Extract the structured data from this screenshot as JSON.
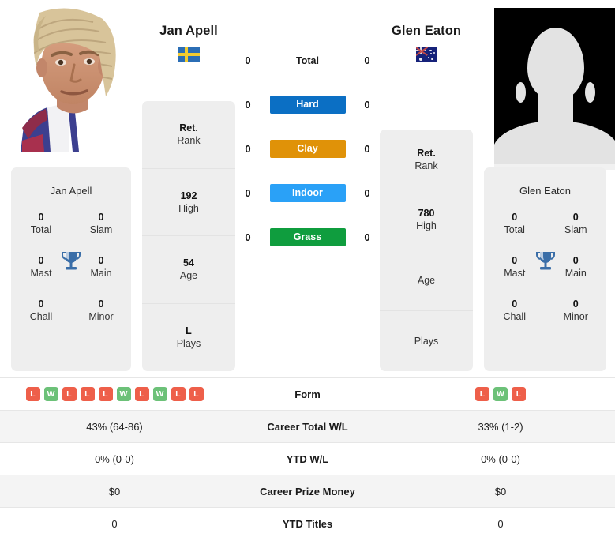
{
  "players": {
    "left": {
      "name": "Jan Apell",
      "flag": "sweden-flag",
      "photo": "player-photo",
      "titles_card_name": "Jan Apell",
      "titles": [
        {
          "value": "0",
          "label": "Total"
        },
        {
          "value": "0",
          "label": "Slam"
        },
        {
          "value": "0",
          "label": "Mast"
        },
        {
          "value": "0",
          "label": "Main"
        },
        {
          "value": "0",
          "label": "Chall"
        },
        {
          "value": "0",
          "label": "Minor"
        }
      ],
      "profile": [
        {
          "value": "Ret.",
          "label": "Rank"
        },
        {
          "value": "192",
          "label": "High"
        },
        {
          "value": "54",
          "label": "Age"
        },
        {
          "value": "L",
          "label": "Plays"
        }
      ],
      "form": [
        "L",
        "W",
        "L",
        "L",
        "L",
        "W",
        "L",
        "W",
        "L",
        "L"
      ],
      "career_total_wl": "43% (64-86)",
      "ytd_wl": "0% (0-0)",
      "career_prize_money": "$0",
      "ytd_titles": "0"
    },
    "right": {
      "name": "Glen Eaton",
      "flag": "australia-flag",
      "photo": "avatar-placeholder",
      "titles_card_name": "Glen Eaton",
      "titles": [
        {
          "value": "0",
          "label": "Total"
        },
        {
          "value": "0",
          "label": "Slam"
        },
        {
          "value": "0",
          "label": "Mast"
        },
        {
          "value": "0",
          "label": "Main"
        },
        {
          "value": "0",
          "label": "Chall"
        },
        {
          "value": "0",
          "label": "Minor"
        }
      ],
      "profile": [
        {
          "value": "Ret.",
          "label": "Rank"
        },
        {
          "value": "780",
          "label": "High"
        },
        {
          "value": "",
          "label": "Age"
        },
        {
          "value": "",
          "label": "Plays"
        }
      ],
      "form": [
        "L",
        "W",
        "L"
      ],
      "career_total_wl": "33% (1-2)",
      "ytd_wl": "0% (0-0)",
      "career_prize_money": "$0",
      "ytd_titles": "0"
    }
  },
  "h2h": [
    {
      "label": "Total",
      "left": "0",
      "right": "0",
      "badge": false,
      "color": ""
    },
    {
      "label": "Hard",
      "left": "0",
      "right": "0",
      "badge": true,
      "color": "#0b6fc4"
    },
    {
      "label": "Clay",
      "left": "0",
      "right": "0",
      "badge": true,
      "color": "#e09208"
    },
    {
      "label": "Indoor",
      "left": "0",
      "right": "0",
      "badge": true,
      "color": "#2aa1f7"
    },
    {
      "label": "Grass",
      "left": "0",
      "right": "0",
      "badge": true,
      "color": "#0f9d3e"
    }
  ],
  "table_rows": [
    {
      "label": "Form",
      "type": "form"
    },
    {
      "label": "Career Total W/L",
      "type": "text",
      "key": "career_total_wl"
    },
    {
      "label": "YTD W/L",
      "type": "text",
      "key": "ytd_wl"
    },
    {
      "label": "Career Prize Money",
      "type": "text",
      "key": "career_prize_money"
    },
    {
      "label": "YTD Titles",
      "type": "text",
      "key": "ytd_titles"
    }
  ],
  "colors": {
    "win_badge": "#6cc178",
    "loss_badge": "#ee5f4a",
    "trophy": "#3a6ea8",
    "card_bg": "#eeeeee",
    "row_alt": "#f4f4f4"
  }
}
